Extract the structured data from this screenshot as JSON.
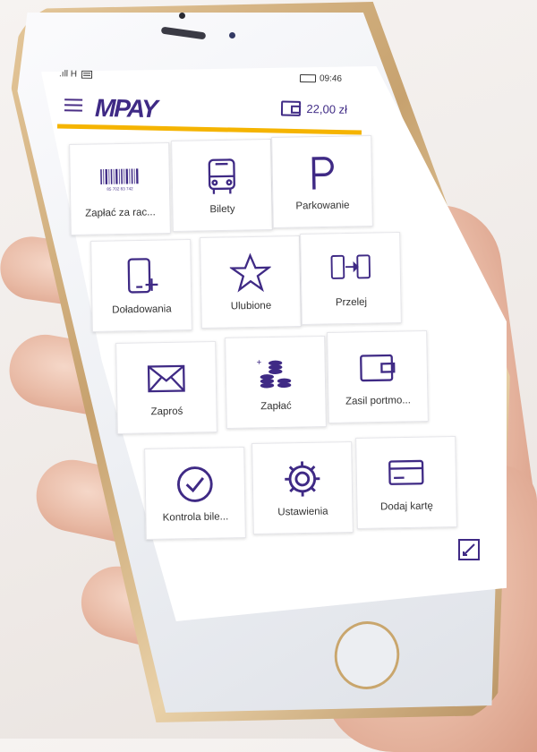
{
  "status": {
    "signal": ".ıll H",
    "time": "09:46"
  },
  "header": {
    "logo": "MPAY",
    "balance": "22,00 zł"
  },
  "tiles": [
    {
      "label": "Zapłać za rac...",
      "icon": "barcode-icon",
      "barcode_digits": "85 702 83 742"
    },
    {
      "label": "Bilety",
      "icon": "bus-icon"
    },
    {
      "label": "Parkowanie",
      "icon": "parking-icon"
    },
    {
      "label": "Doładowania",
      "icon": "phone-topup-icon"
    },
    {
      "label": "Ulubione",
      "icon": "star-icon"
    },
    {
      "label": "Przelej",
      "icon": "transfer-icon"
    },
    {
      "label": "Zaproś",
      "icon": "envelope-icon"
    },
    {
      "label": "Zapłać",
      "icon": "coins-icon"
    },
    {
      "label": "Zasil portmo...",
      "icon": "wallet-icon"
    },
    {
      "label": "Kontrola bile...",
      "icon": "check-circle-icon"
    },
    {
      "label": "Ustawienia",
      "icon": "gear-icon"
    },
    {
      "label": "Dodaj kartę",
      "icon": "card-icon"
    }
  ],
  "colors": {
    "primary": "#3f2a85",
    "accent": "#f5b400",
    "tile_border": "#e6e6ea"
  }
}
